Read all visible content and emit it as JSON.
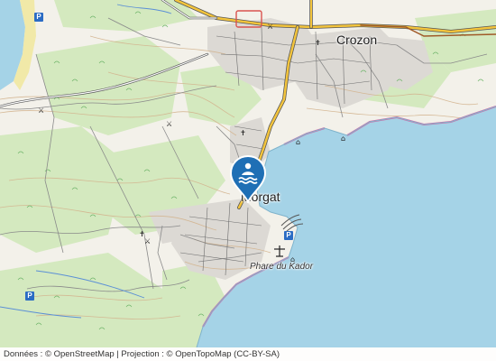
{
  "map": {
    "labels": {
      "crozon": "Crozon",
      "morgat": "Morgat",
      "phare": "Phare du Kador"
    },
    "marker": {
      "icon": "swimming-beach-icon",
      "color": "#1f6fb5"
    },
    "parking_label": "P",
    "colors": {
      "sea": "#a5d3e7",
      "land": "#f3f1ea",
      "forest": "#cfe7b8",
      "urban": "#d9d6d2",
      "road_main": "#f5c242",
      "contour": "#c9a77c",
      "cliff": "#d06fa8"
    }
  },
  "attribution": {
    "text": "Données : © OpenStreetMap | Projection : © OpenTopoMap (CC-BY-SA)"
  }
}
